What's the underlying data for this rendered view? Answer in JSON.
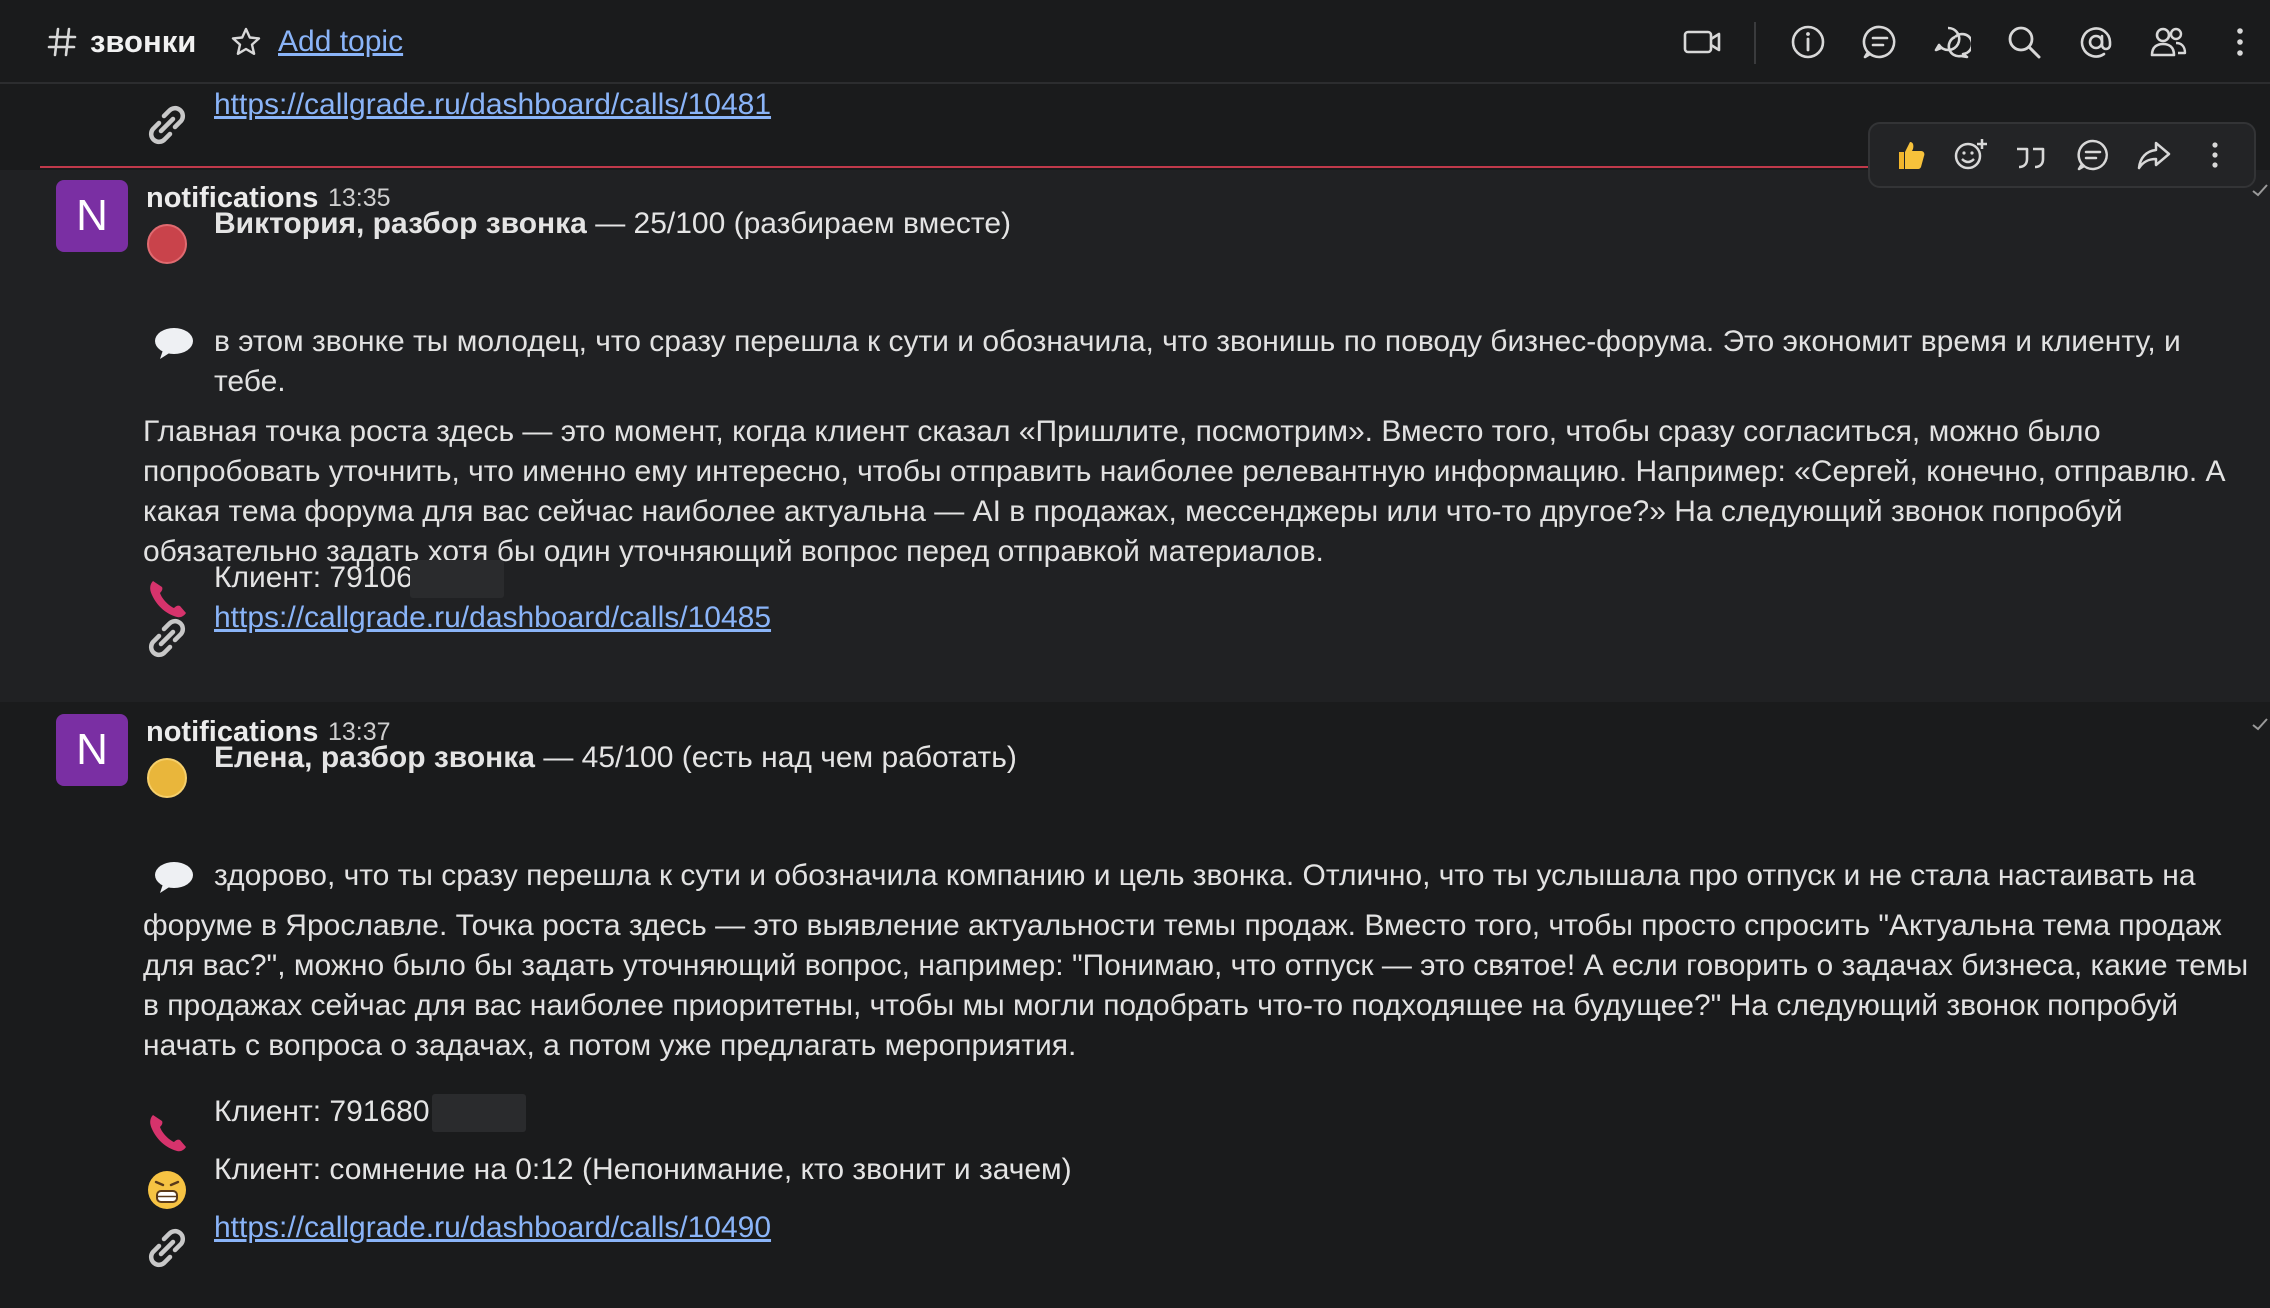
{
  "header": {
    "channel_name": "звонки",
    "add_topic": "Add topic",
    "icons": [
      "hash-icon",
      "star-icon",
      "video-call-icon",
      "info-icon",
      "threads-icon",
      "discussion-icon",
      "search-icon",
      "mentions-icon",
      "members-icon",
      "kebab-menu-icon"
    ]
  },
  "prev_message": {
    "link": "https://callgrade.ru/dashboard/calls/10481"
  },
  "toolbar": {
    "icons": [
      "thumbs-up-icon",
      "add-reaction-icon",
      "quote-icon",
      "reply-thread-icon",
      "forward-icon",
      "more-icon"
    ]
  },
  "messages": [
    {
      "avatar_letter": "N",
      "sender": "notifications",
      "time": "13:35",
      "status_icon": "red-circle-icon",
      "title_bold": "Виктория, разбор звонка",
      "title_rest": " — 25/100 (разбираем вместе)",
      "feedback_first": "в этом звонке ты молодец, что сразу перешла к сути и обозначила, что звонишь по поводу бизнес-форума. Это экономит время и клиенту, и тебе.",
      "feedback_lines": [
        "Главная точка роста здесь — это момент, когда клиент сказал «Пришлите, посмотрим». Вместо того, чтобы сразу согласиться, можно было",
        "попробовать уточнить, что именно ему интересно, чтобы отправить наиболее релевантную информацию. Например: «Сергей, конечно, отправлю. А",
        "какая тема форума для вас сейчас наиболее актуальна — AI в продажах, мессенджеры или что-то другое?» На следующий звонок попробуй",
        "обязательно задать хотя бы один уточняющий вопрос перед отправкой материалов."
      ],
      "client_label": "Клиент: 791068",
      "link": "https://callgrade.ru/dashboard/calls/10485"
    },
    {
      "avatar_letter": "N",
      "sender": "notifications",
      "time": "13:37",
      "status_icon": "yellow-circle-icon",
      "title_bold": "Елена, разбор звонка",
      "title_rest": " — 45/100 (есть над чем работать)",
      "feedback_first": "здорово, что ты сразу перешла к сути и обозначила компанию и цель звонка. Отлично, что ты услышала про отпуск и не стала настаивать на",
      "feedback_lines": [
        "форуме в Ярославле. Точка роста здесь — это выявление актуальности темы продаж. Вместо того, чтобы просто спросить \"Актуальна тема продаж",
        "для вас?\", можно было бы задать уточняющий вопрос, например: \"Понимаю, что отпуск — это святое! А если говорить о задачах бизнеса, какие темы",
        "в продажах сейчас для вас наиболее приоритетны, чтобы мы могли подобрать что-то подходящее на будущее?\" На следующий звонок попробуй",
        "начать с вопроса о задачах, а потом уже предлагать мероприятия."
      ],
      "client_label": "Клиент: 791680",
      "doubt": "Клиент: сомнение на 0:12 (Непонимание, кто звонит и зачем)",
      "link": "https://callgrade.ru/dashboard/calls/10490"
    }
  ],
  "colors": {
    "accent_link": "#8ab4f8",
    "avatar": "#7a2fa3",
    "unread_line": "#c0394a"
  }
}
